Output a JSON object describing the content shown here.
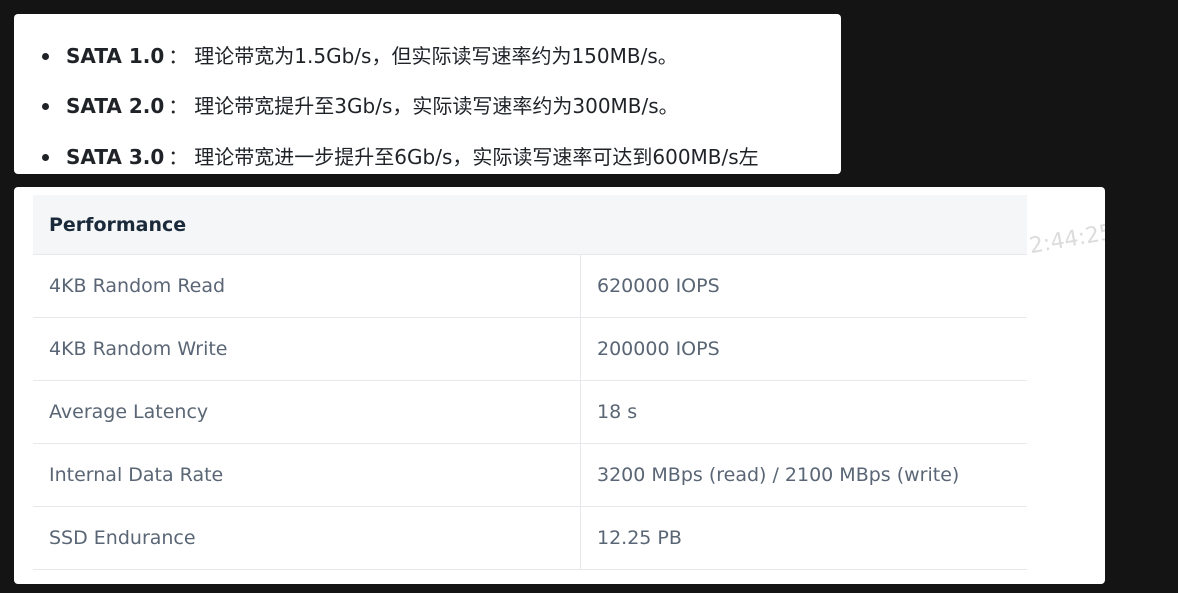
{
  "sata_list": [
    {
      "label": "SATA 1.0",
      "sep": "：",
      "text": "理论带宽为1.5Gb/s，但实际读写速率约为150MB/s。"
    },
    {
      "label": "SATA 2.0",
      "sep": "：",
      "text": "理论带宽提升至3Gb/s，实际读写速率约为300MB/s。"
    },
    {
      "label": "SATA 3.0",
      "sep": "：",
      "text": "理论带宽进一步提升至6Gb/s，实际读写速率可达到600MB/s左"
    }
  ],
  "watermark": "2:44:25",
  "performance": {
    "header": "Performance",
    "rows": [
      {
        "key": "4KB Random Read",
        "value": "620000 IOPS"
      },
      {
        "key": "4KB Random Write",
        "value": "200000 IOPS"
      },
      {
        "key": "Average Latency",
        "value": "18 s"
      },
      {
        "key": "Internal Data Rate",
        "value": "3200 MBps (read) / 2100 MBps (write)"
      },
      {
        "key": "SSD Endurance",
        "value": "12.25 PB"
      }
    ]
  }
}
